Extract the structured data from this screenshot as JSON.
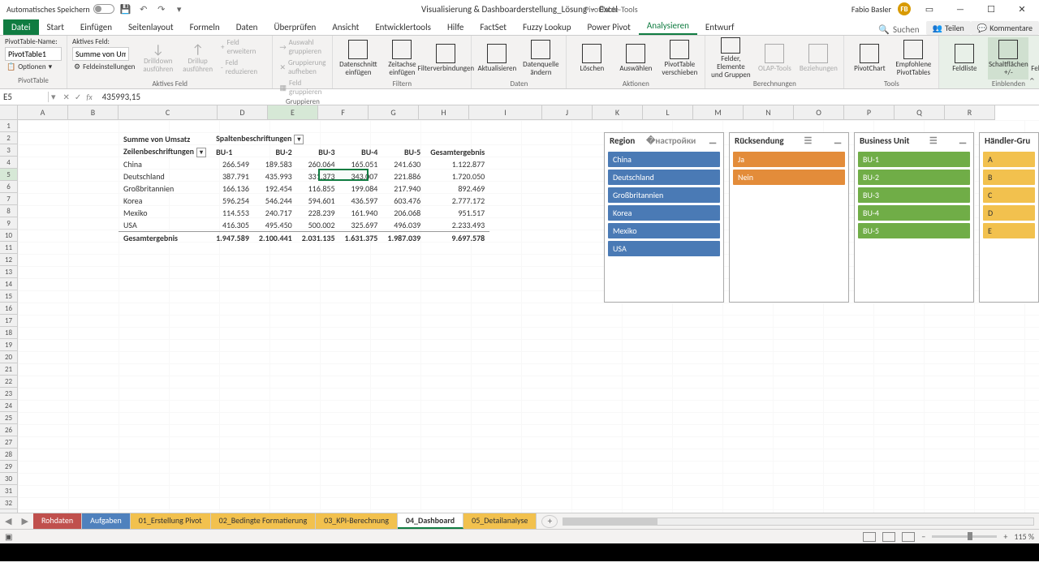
{
  "titlebar": {
    "autosave_label": "Automatisches Speichern",
    "doc_name": "Visualisierung & Dashboarderstellung_Lösung",
    "app_name": "Excel",
    "contextual": "PivotTable-Tools",
    "user_name": "Fabio Basler",
    "user_initials": "FB"
  },
  "tabs": {
    "file": "Datei",
    "items": [
      "Start",
      "Einfügen",
      "Seitenlayout",
      "Formeln",
      "Daten",
      "Überprüfen",
      "Ansicht",
      "Entwicklertools",
      "Hilfe",
      "FactSet",
      "Fuzzy Lookup",
      "Power Pivot",
      "Analysieren",
      "Entwurf"
    ],
    "active": "Analysieren",
    "search": "Suchen",
    "share": "Teilen",
    "comments": "Kommentare"
  },
  "ribbon": {
    "g1_label": "PivotTable",
    "pt_name_label": "PivotTable-Name:",
    "pt_name": "PivotTable1",
    "pt_options": "Optionen",
    "g2_label": "Aktives Feld",
    "af_label": "Aktives Feld:",
    "af_value": "Summe von Ums",
    "af_settings": "Feldeinstellungen",
    "drilldown": "Drilldown ausführen",
    "drillup": "Drillup ausführen",
    "expand": "Feld erweitern",
    "collapse": "Feld reduzieren",
    "g3_label": "Gruppieren",
    "grp1": "Auswahl gruppieren",
    "grp2": "Gruppierung aufheben",
    "grp3": "Feld gruppieren",
    "g4_label": "Filtern",
    "slicer_btn": "Datenschnitt einfügen",
    "timeline_btn": "Zeitachse einfügen",
    "filter_conn": "Filterverbindungen",
    "g5_label": "Daten",
    "refresh": "Aktualisieren",
    "change_src": "Datenquelle ändern",
    "g6_label": "Aktionen",
    "clear": "Löschen",
    "select": "Auswählen",
    "move": "PivotTable verschieben",
    "g7_label": "Berechnungen",
    "fields_items": "Felder, Elemente und Gruppen",
    "olap": "OLAP-Tools",
    "relations": "Beziehungen",
    "g8_label": "Tools",
    "pivotchart": "PivotChart",
    "recommended": "Empfohlene PivotTables",
    "g9_label": "Einblenden",
    "fieldlist": "Feldliste",
    "buttons_pm": "Schaltflächen +/-",
    "field_headers": "Feldkopfzeilen"
  },
  "formula": {
    "cell_ref": "E5",
    "value": "435993,15"
  },
  "columns": [
    "A",
    "B",
    "C",
    "D",
    "E",
    "F",
    "G",
    "H",
    "I",
    "J",
    "K",
    "L",
    "M",
    "N",
    "O",
    "P",
    "Q",
    "R"
  ],
  "pivot": {
    "measure": "Summe von Umsatz",
    "col_label": "Spaltenbeschriftungen",
    "row_label": "Zeilenbeschriftungen",
    "cols": [
      "BU-1",
      "BU-2",
      "BU-3",
      "BU-4",
      "BU-5",
      "Gesamtergebnis"
    ],
    "rows": [
      {
        "label": "China",
        "v": [
          "266.549",
          "189.583",
          "260.064",
          "165.051",
          "241.630",
          "1.122.877"
        ]
      },
      {
        "label": "Deutschland",
        "v": [
          "387.791",
          "435.993",
          "331.373",
          "343.007",
          "221.886",
          "1.720.050"
        ]
      },
      {
        "label": "Großbritannien",
        "v": [
          "166.136",
          "192.454",
          "116.855",
          "199.084",
          "217.940",
          "892.469"
        ]
      },
      {
        "label": "Korea",
        "v": [
          "596.254",
          "546.244",
          "594.601",
          "436.597",
          "603.476",
          "2.777.172"
        ]
      },
      {
        "label": "Mexiko",
        "v": [
          "114.553",
          "240.717",
          "228.239",
          "161.940",
          "206.068",
          "951.517"
        ]
      },
      {
        "label": "USA",
        "v": [
          "416.305",
          "495.450",
          "500.002",
          "325.697",
          "496.039",
          "2.233.493"
        ]
      }
    ],
    "total_label": "Gesamtergebnis",
    "total": [
      "1.947.589",
      "2.100.441",
      "2.031.135",
      "1.631.375",
      "1.987.039",
      "9.697.578"
    ]
  },
  "slicers": {
    "region": {
      "title": "Region",
      "items": [
        "China",
        "Deutschland",
        "Großbritannien",
        "Korea",
        "Mexiko",
        "USA"
      ]
    },
    "return": {
      "title": "Rücksendung",
      "items": [
        "Ja",
        "Nein"
      ]
    },
    "bu": {
      "title": "Business Unit",
      "items": [
        "BU-1",
        "BU-2",
        "BU-3",
        "BU-4",
        "BU-5"
      ]
    },
    "dealer": {
      "title": "Händler-Gru",
      "items": [
        "A",
        "B",
        "C",
        "D",
        "E"
      ]
    }
  },
  "sheets": {
    "items": [
      {
        "label": "Rohdaten",
        "cls": "st-red"
      },
      {
        "label": "Aufgaben",
        "cls": "st-blue"
      },
      {
        "label": "01_Erstellung Pivot",
        "cls": "st-yellow"
      },
      {
        "label": "02_Bedingte Formatierung",
        "cls": "st-yellow"
      },
      {
        "label": "03_KPI-Berechnung",
        "cls": "st-yellow"
      },
      {
        "label": "04_Dashboard",
        "cls": "active"
      },
      {
        "label": "05_Detailanalyse",
        "cls": "st-yellow"
      }
    ]
  },
  "status": {
    "zoom": "115 %"
  }
}
